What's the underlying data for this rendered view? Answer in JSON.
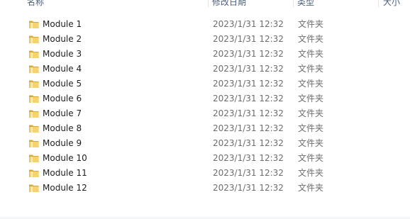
{
  "columns": {
    "name": "名称",
    "date_modified": "修改日期",
    "type": "类型",
    "size": "大小"
  },
  "icon": "folder-icon",
  "files": [
    {
      "name": "Module 1",
      "date": "2023/1/31 12:32",
      "type": "文件夹"
    },
    {
      "name": "Module 2",
      "date": "2023/1/31 12:32",
      "type": "文件夹"
    },
    {
      "name": "Module 3",
      "date": "2023/1/31 12:32",
      "type": "文件夹"
    },
    {
      "name": "Module 4",
      "date": "2023/1/31 12:32",
      "type": "文件夹"
    },
    {
      "name": "Module 5",
      "date": "2023/1/31 12:32",
      "type": "文件夹"
    },
    {
      "name": "Module 6",
      "date": "2023/1/31 12:32",
      "type": "文件夹"
    },
    {
      "name": "Module 7",
      "date": "2023/1/31 12:32",
      "type": "文件夹"
    },
    {
      "name": "Module 8",
      "date": "2023/1/31 12:32",
      "type": "文件夹"
    },
    {
      "name": "Module 9",
      "date": "2023/1/31 12:32",
      "type": "文件夹"
    },
    {
      "name": "Module 10",
      "date": "2023/1/31 12:32",
      "type": "文件夹"
    },
    {
      "name": "Module 11",
      "date": "2023/1/31 12:32",
      "type": "文件夹"
    },
    {
      "name": "Module 12",
      "date": "2023/1/31 12:32",
      "type": "文件夹"
    }
  ]
}
